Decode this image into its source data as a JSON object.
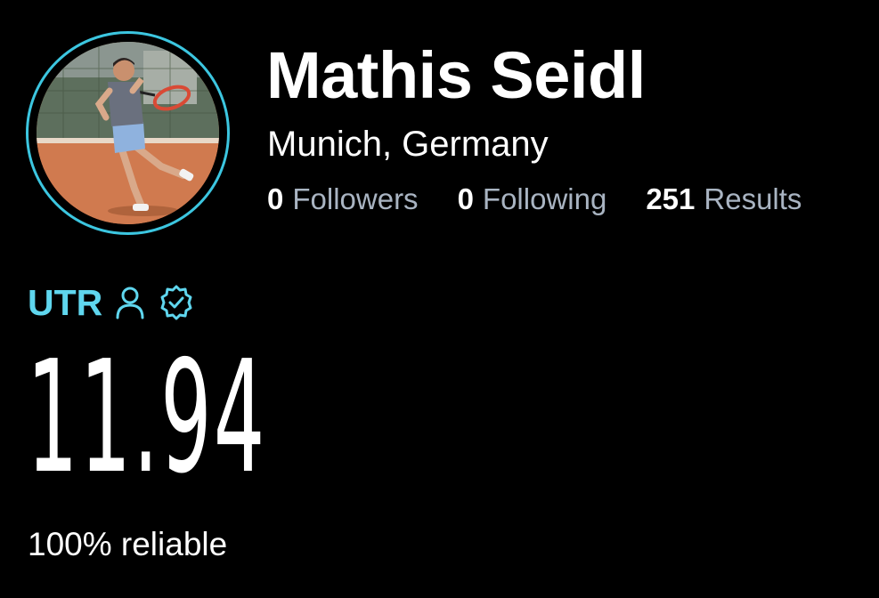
{
  "profile": {
    "name": "Mathis Seidl",
    "location": "Munich, Germany",
    "avatar_icon": "tennis-player-photo"
  },
  "stats": {
    "followers": {
      "count": "0",
      "label": "Followers"
    },
    "following": {
      "count": "0",
      "label": "Following"
    },
    "results": {
      "count": "251",
      "label": "Results"
    }
  },
  "utr": {
    "label": "UTR",
    "icons": [
      "person-icon",
      "verified-badge-icon"
    ],
    "rating": "11.94",
    "reliability": "100% reliable"
  },
  "colors": {
    "background": "#000000",
    "accent": "#5fd6ee",
    "ring": "#3cc6e0",
    "muted_text": "#a9b4c2"
  }
}
